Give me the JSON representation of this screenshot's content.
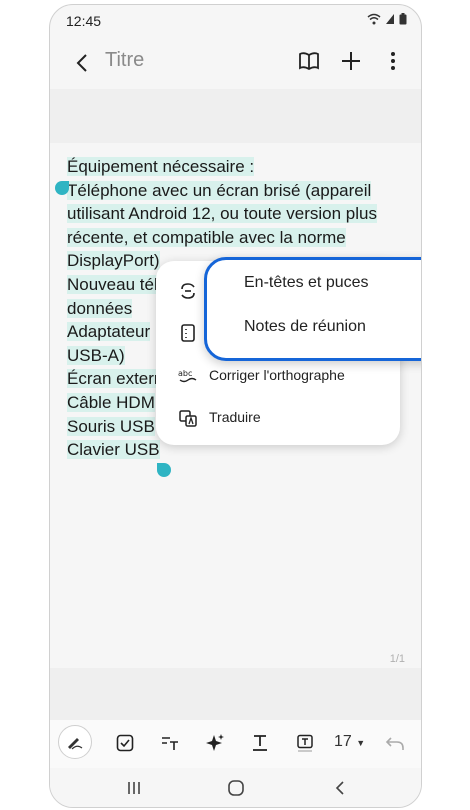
{
  "status_bar": {
    "time": "12:45"
  },
  "app_bar": {
    "title": "Titre"
  },
  "note": {
    "lines": [
      "Équipement nécessaire :",
      "Téléphone avec un écran brisé (appareil",
      "utilisant Android 12, ou toute version plus",
      "récente, et compatible avec la norme",
      "DisplayPort)",
      "Nouveau tél",
      "données",
      "Adaptateur",
      "USB-A)",
      "Écran extern",
      "Câble HDM",
      "Souris USB",
      "Clavier USB"
    ],
    "page_indicator": "1/1"
  },
  "context_menu": {
    "items": [
      {
        "label": "Corriger l'orthographe",
        "icon": "spellcheck-icon"
      },
      {
        "label": "Traduire",
        "icon": "translate-icon"
      }
    ]
  },
  "submenu": {
    "items": [
      {
        "label": "En-têtes et puces"
      },
      {
        "label": "Notes de réunion"
      }
    ],
    "border_color": "#1565d8"
  },
  "toolbar": {
    "font_size": "17"
  },
  "selection_color": "#d8f1ec",
  "handle_color": "#2fb4c3"
}
